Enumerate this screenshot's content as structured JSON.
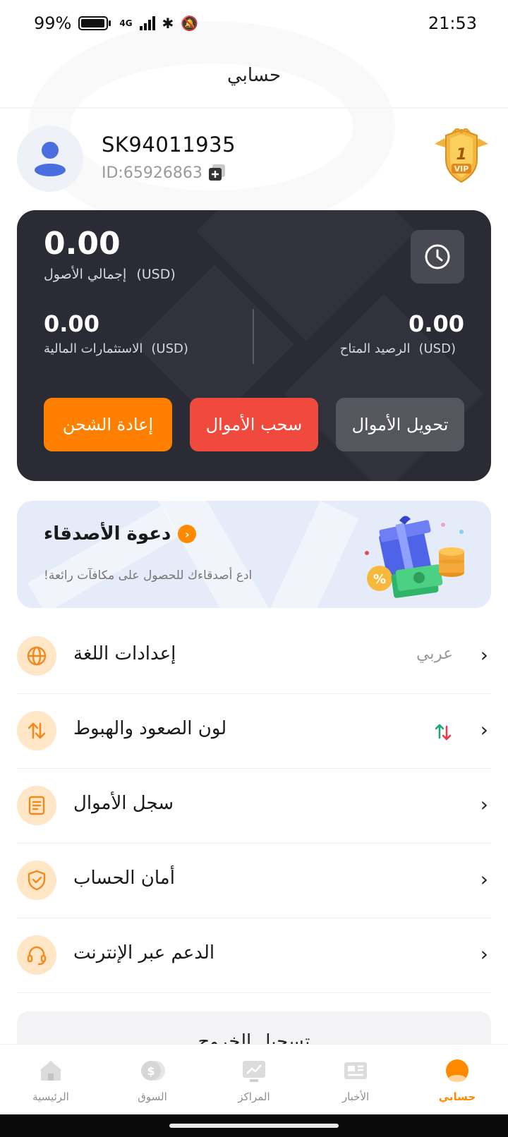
{
  "status_bar": {
    "battery": "99%",
    "network": "4G",
    "time": "21:53"
  },
  "header": {
    "title": "حسابي"
  },
  "profile": {
    "username": "SK94011935",
    "id": "ID:65926863",
    "vip_level": "1",
    "vip_text": "VIP"
  },
  "assets": {
    "total_value": "0.00",
    "total_label": "إجمالي الأصول",
    "total_currency": "(USD)",
    "investments_value": "0.00",
    "investments_label": "الاستثمارات المالية",
    "investments_currency": "(USD)",
    "available_value": "0.00",
    "available_label": "الرصيد المتاح",
    "available_currency": "(USD)",
    "buttons": {
      "recharge": "إعادة الشحن",
      "withdraw": "سحب الأموال",
      "transfer": "تحويل الأموال"
    },
    "colors": {
      "card": "#2a2b35",
      "recharge": "#ff8000",
      "withdraw": "#f04a3e",
      "transfer": "#55565e"
    }
  },
  "invite": {
    "title": "دعوة الأصدقاء",
    "subtitle": "!ادع أصدقاءك للحصول على مكافآت رائعة"
  },
  "menu": {
    "items": [
      {
        "label": "إعدادات اللغة",
        "value": "عربي",
        "icon": "globe-icon"
      },
      {
        "label": "لون الصعود والهبوط",
        "value": "",
        "icon": "swap-arrows-icon"
      },
      {
        "label": "سجل الأموال",
        "value": "",
        "icon": "document-icon"
      },
      {
        "label": "أمان الحساب",
        "value": "",
        "icon": "shield-check-icon"
      },
      {
        "label": "الدعم عبر الإنترنت",
        "value": "",
        "icon": "headset-icon"
      }
    ],
    "logout": "تسجيل الخروج"
  },
  "tabs": [
    {
      "label": "الرئيسية",
      "icon": "home-icon",
      "active": false
    },
    {
      "label": "السوق",
      "icon": "market-icon",
      "active": false
    },
    {
      "label": "المراكز",
      "icon": "positions-icon",
      "active": false
    },
    {
      "label": "الأخبار",
      "icon": "news-icon",
      "active": false
    },
    {
      "label": "حسابي",
      "icon": "account-icon",
      "active": true
    }
  ],
  "accent_color": "#ff8a00"
}
